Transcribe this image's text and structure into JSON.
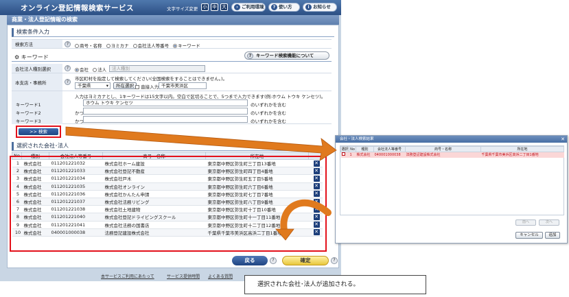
{
  "app": {
    "title": "オンライン登記情報検索サービス",
    "font_size_label": "文字サイズ変更",
    "font_sizes": [
      "小",
      "中",
      "大"
    ],
    "env_button": "ご利用環境",
    "howto_button": "使い方",
    "news_button": "お知らせ"
  },
  "page": {
    "title": "商業・法人登記情報の検索",
    "section_search": "検索条件入力",
    "section_keyword": "キーワード",
    "section_selected": "選択された会社･法人"
  },
  "search_method": {
    "label": "検索方法",
    "options": [
      "商号・名称",
      "ヨミカナ",
      "会社法人等番号",
      "キーワード"
    ],
    "selected": "キーワード"
  },
  "keyword_help_button": "キーワード検索機能について",
  "company_type": {
    "label": "会社法人種別選択",
    "option_company": "会社",
    "option_corp": "法人",
    "select_placeholder": "法人種別"
  },
  "office": {
    "label": "本支店・事務所",
    "hint": "市区町村を指定して検索してください(全国検索をすることはできません。)。",
    "prefecture": "千葉県",
    "location_button": "所在選択",
    "direct_input_label": "直接入力",
    "city": "千葉市美浜区"
  },
  "keywords": {
    "hint": "入力はヨミカナとし、1キーワードは15文字以内。空白で区切ることで、5つまで入力できます(例:ホウム トウキ ケンセツ)。",
    "rows": [
      {
        "label": "キーワード1",
        "prefix": "",
        "value": "ホウム トウキ ケンセツ",
        "suffix": "のいずれかを含む"
      },
      {
        "label": "キーワード2",
        "prefix": "かつ",
        "value": "",
        "suffix": "のいずれかを含む"
      },
      {
        "label": "キーワード3",
        "prefix": "かつ",
        "value": "",
        "suffix": "のいずれかを含む"
      }
    ]
  },
  "search_button": ">> 検索",
  "results": {
    "headers": [
      "No",
      "種別",
      "会社法人等番号",
      "商号・名称",
      "所在地",
      ""
    ],
    "rows": [
      {
        "no": "1",
        "type": "株式会社",
        "number": "011201221032",
        "name": "株式会社ホーム建設",
        "address": "東京都中野区弥生町三丁目13番地"
      },
      {
        "no": "2",
        "type": "株式会社",
        "number": "011201221033",
        "name": "株式会社登記不動産",
        "address": "東京都中野区弥生町四丁目4番地"
      },
      {
        "no": "3",
        "type": "株式会社",
        "number": "011201221034",
        "name": "株式会社戸木",
        "address": "東京都中野区弥生町五丁目5番地"
      },
      {
        "no": "4",
        "type": "株式会社",
        "number": "011201221035",
        "name": "株式会社オンライン",
        "address": "東京都中野区弥生町六丁目6番地"
      },
      {
        "no": "5",
        "type": "株式会社",
        "number": "011201221036",
        "name": "株式会社かんたん申請",
        "address": "東京都中野区弥生町七丁目7番地"
      },
      {
        "no": "6",
        "type": "株式会社",
        "number": "011201221037",
        "name": "株式会社法務リビング",
        "address": "東京都中野区弥生町八丁目9番地"
      },
      {
        "no": "7",
        "type": "株式会社",
        "number": "011201221038",
        "name": "株式会社土地建物",
        "address": "東京都中野区弥生町十丁目10番地"
      },
      {
        "no": "8",
        "type": "株式会社",
        "number": "011201221040",
        "name": "株式会社登記ドライビングスクール",
        "address": "東京都中野区弥生町十一丁目11番地"
      },
      {
        "no": "9",
        "type": "株式会社",
        "number": "011201221041",
        "name": "株式会社法務の国書店",
        "address": "東京都中野区弥生町十二丁目12番地"
      },
      {
        "no": "10",
        "type": "株式会社",
        "number": "040001000038",
        "name": "法務登記建設株式会社",
        "address": "千葉県千葉市美浜区高浜二丁目1番地"
      }
    ]
  },
  "back_button": "戻る",
  "confirm_button": "確定",
  "footer_links": [
    "本サービスご利用にあたって",
    "サービス提供時間",
    "よくある質問"
  ],
  "dialog": {
    "title": "会社・法人検索結果",
    "headers": [
      "選択",
      "No",
      "種別",
      "会社法人等番号",
      "商号・名称",
      "所在地"
    ],
    "row": {
      "no": "1",
      "type": "株式会社",
      "number": "040001000038",
      "name": "法務登記建設株式会社",
      "address": "千葉県千葉市美浜区高浜二丁目1番地"
    },
    "prev_button": "前へ",
    "next_button": "次へ",
    "cancel_button": "キャンセル",
    "add_button": "追加"
  },
  "caption": "選択された会社･法人が追加される。",
  "colors": {
    "highlight": "#e3101a",
    "arrow": "#e07a1e",
    "header_blue": "#2c4f84"
  }
}
